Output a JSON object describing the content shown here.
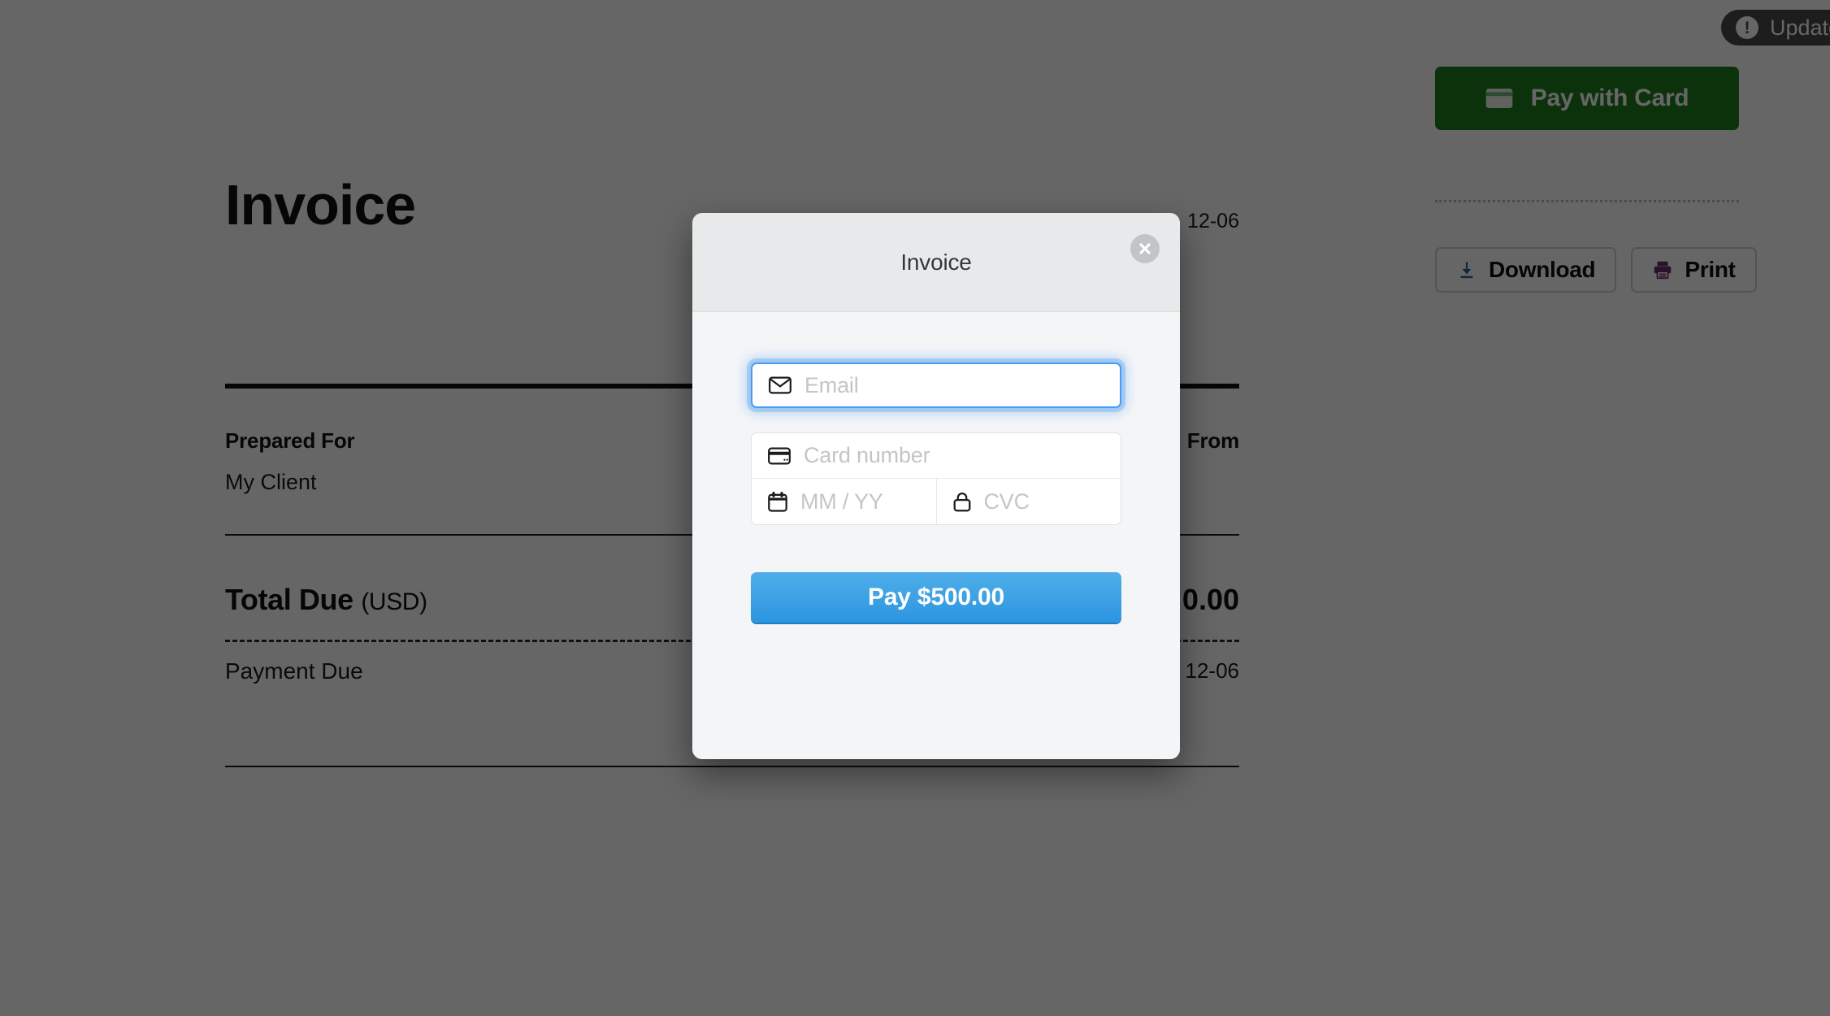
{
  "invoice": {
    "title": "Invoice",
    "top_meta": "12-06",
    "prepared_for_label": "Prepared For",
    "prepared_for_value": "My Client",
    "from_label": "From",
    "from_value": "",
    "total_label": "Total Due",
    "total_currency": "(USD)",
    "total_amount": "0.00",
    "payment_due_label": "Payment Due",
    "payment_due_value": "12-06"
  },
  "rail": {
    "pay_with_card_label": "Pay with Card",
    "pay_with_card_icon": "credit-card-icon",
    "download_label": "Download",
    "download_icon": "download-icon",
    "print_label": "Print",
    "print_icon": "printer-icon",
    "pay_button_color": "#1e7e1e",
    "download_icon_color": "#2a6496",
    "print_icon_color": "#6b2d6b"
  },
  "update_badge": {
    "label": "Update",
    "icon": "alert-circle-icon",
    "glyph": "!"
  },
  "modal": {
    "title": "Invoice",
    "close_icon": "close-icon",
    "email": {
      "placeholder": "Email",
      "value": "",
      "icon": "mail-icon",
      "focused": true
    },
    "card_number": {
      "placeholder": "Card number",
      "value": "",
      "icon": "credit-card-icon"
    },
    "expiry": {
      "placeholder": "MM / YY",
      "value": "",
      "icon": "calendar-icon"
    },
    "cvc": {
      "placeholder": "CVC",
      "value": "",
      "icon": "lock-icon"
    },
    "submit_label": "Pay $500.00",
    "accent_color": "#2b95e0"
  }
}
